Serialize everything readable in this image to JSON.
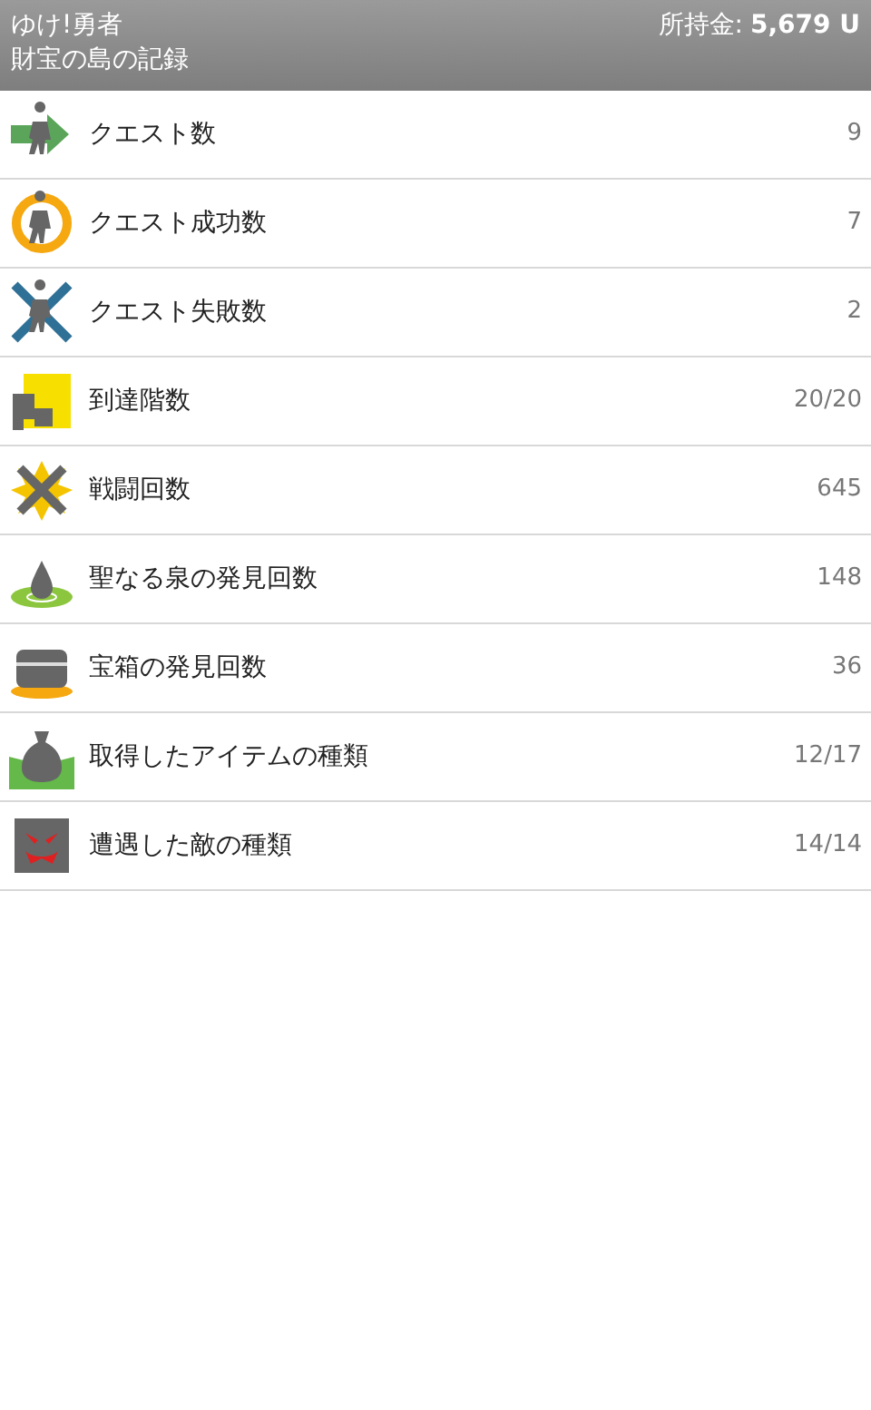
{
  "header": {
    "title": "ゆけ!勇者",
    "subtitle": "財宝の島の記録",
    "money_label": "所持金:",
    "money_value": "5,679 U"
  },
  "stats": [
    {
      "kind": "arrow",
      "label": "クエスト数",
      "value": "9"
    },
    {
      "kind": "ring",
      "label": "クエスト成功数",
      "value": "7"
    },
    {
      "kind": "cross",
      "label": "クエスト失敗数",
      "value": "2"
    },
    {
      "kind": "stairs",
      "label": "到達階数",
      "value": "20/20"
    },
    {
      "kind": "burst",
      "label": "戦闘回数",
      "value": "645"
    },
    {
      "kind": "drop",
      "label": "聖なる泉の発見回数",
      "value": "148"
    },
    {
      "kind": "chest",
      "label": "宝箱の発見回数",
      "value": "36"
    },
    {
      "kind": "bag",
      "label": "取得したアイテムの種類",
      "value": "12/17"
    },
    {
      "kind": "monster",
      "label": "遭遇した敵の種類",
      "value": "14/14"
    }
  ]
}
